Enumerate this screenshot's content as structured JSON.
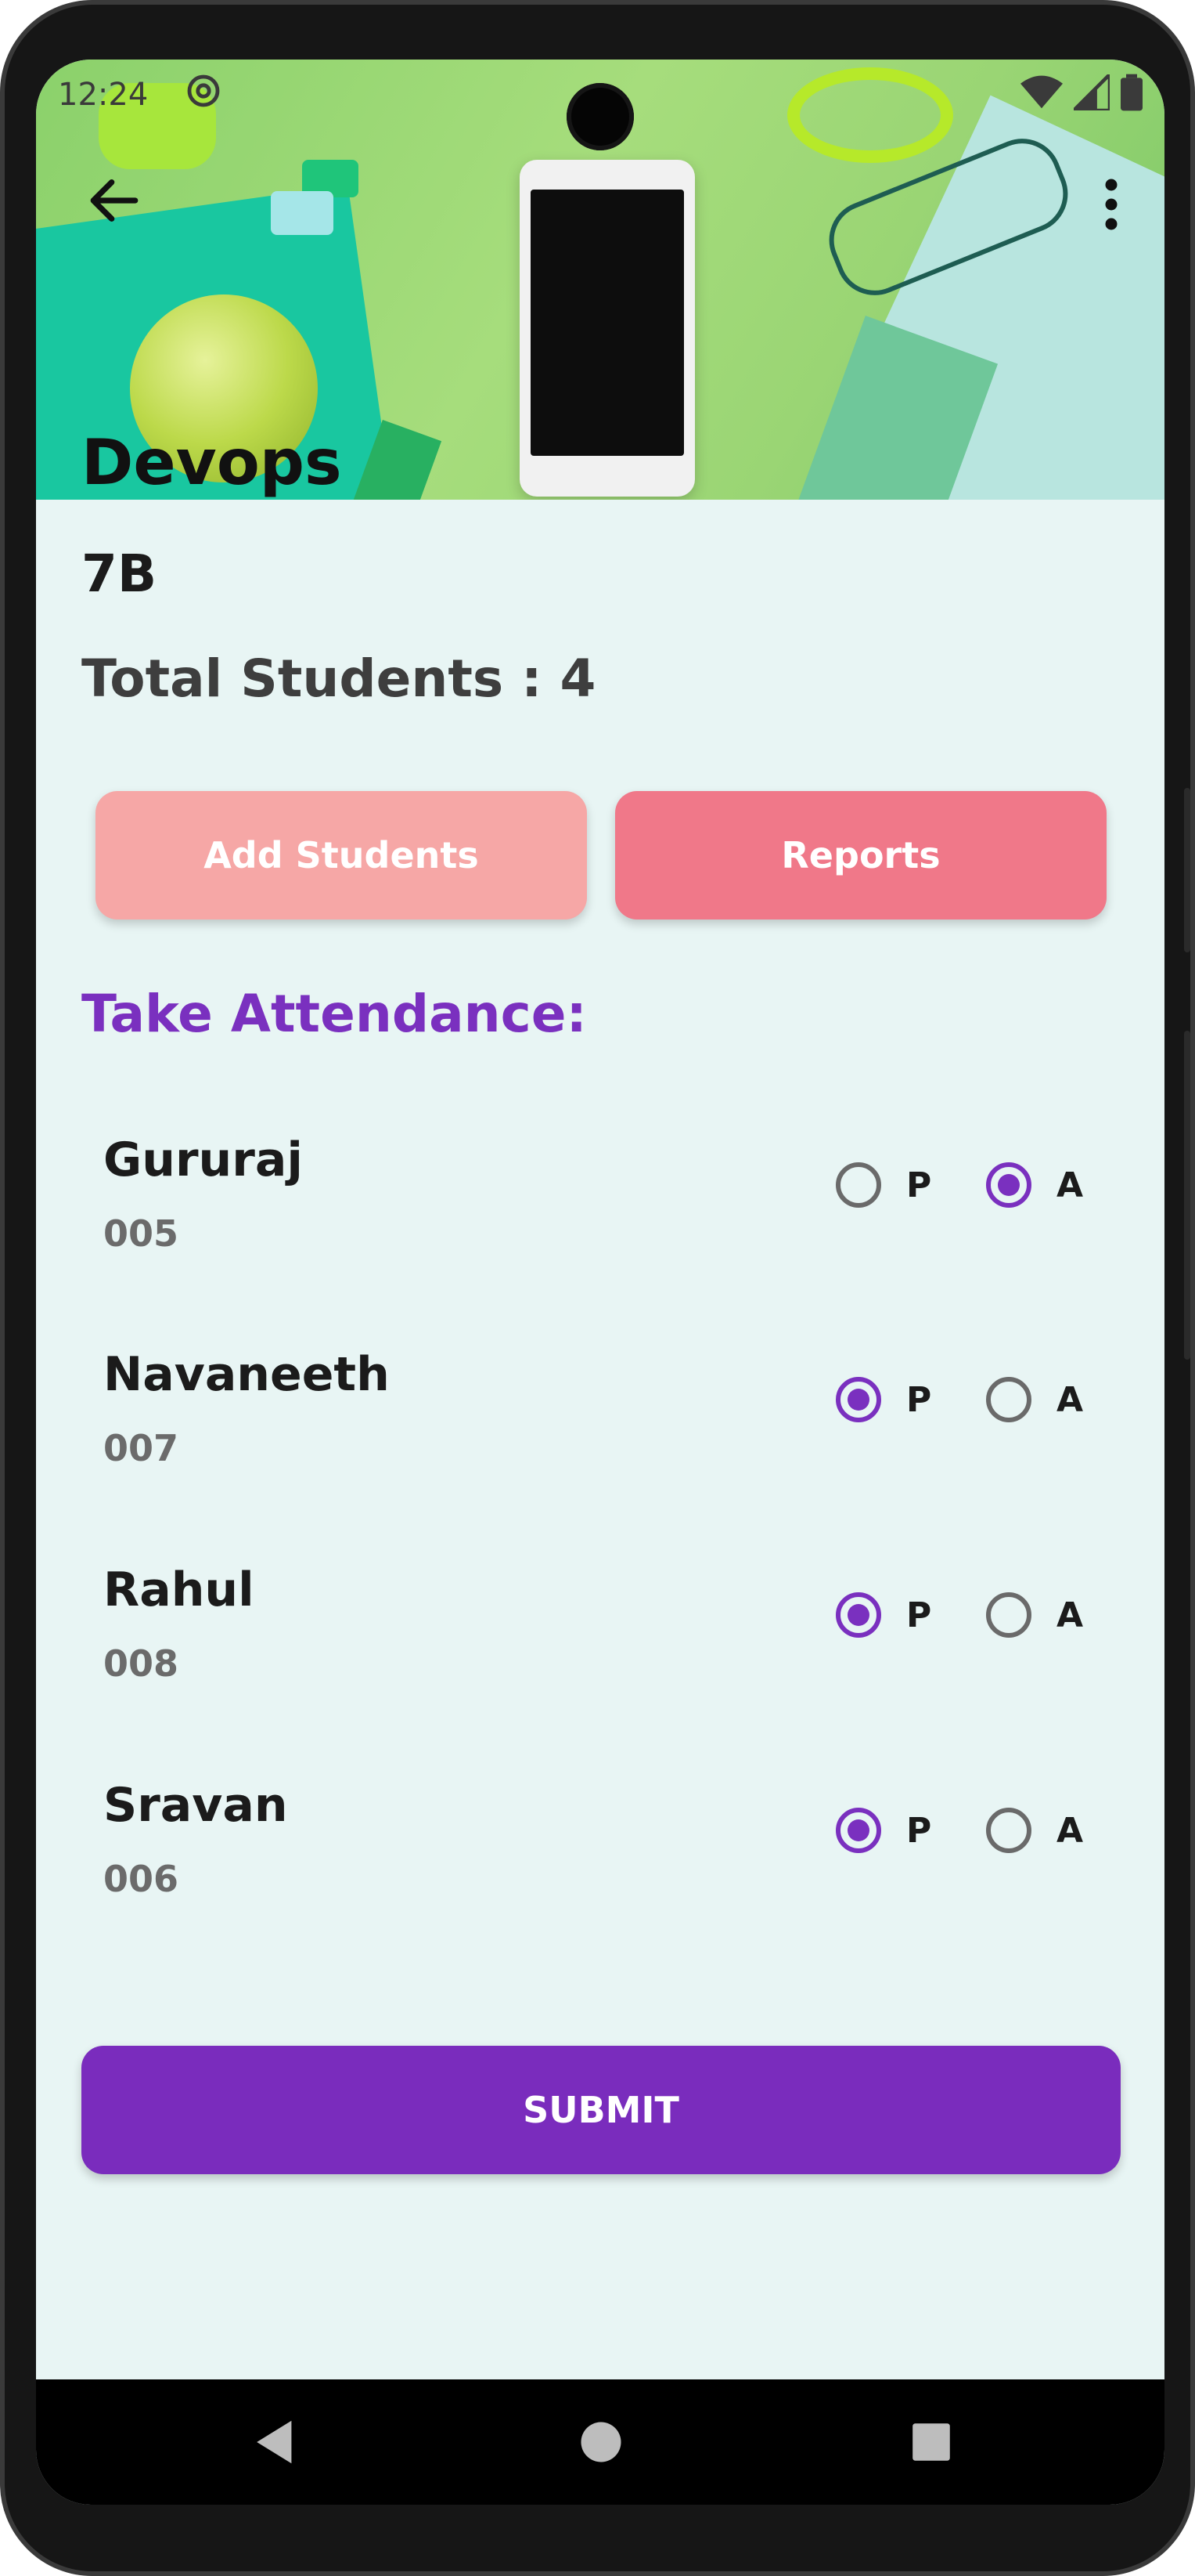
{
  "status_bar": {
    "time": "12:24"
  },
  "header": {
    "title": "Devops",
    "back_icon": "arrow-left-icon",
    "menu_icon": "more-vertical-icon"
  },
  "class_info": {
    "class_name": "7B",
    "total_students": "Total Students : 4"
  },
  "actions": {
    "add_students_label": "Add Students",
    "reports_label": "Reports"
  },
  "attendance": {
    "title": "Take Attendance:",
    "present_label": "P",
    "absent_label": "A",
    "students": [
      {
        "name": "Gururaj",
        "id": "005",
        "status": "A"
      },
      {
        "name": "Navaneeth",
        "id": "007",
        "status": "P"
      },
      {
        "name": "Rahul",
        "id": "008",
        "status": "P"
      },
      {
        "name": "Sravan",
        "id": "006",
        "status": "P"
      }
    ]
  },
  "submit_label": "SUBMIT",
  "colors": {
    "accent": "#7a30bf",
    "add_button": "#f6a7a6",
    "reports_button": "#f07889",
    "background": "#e8f5f4"
  }
}
